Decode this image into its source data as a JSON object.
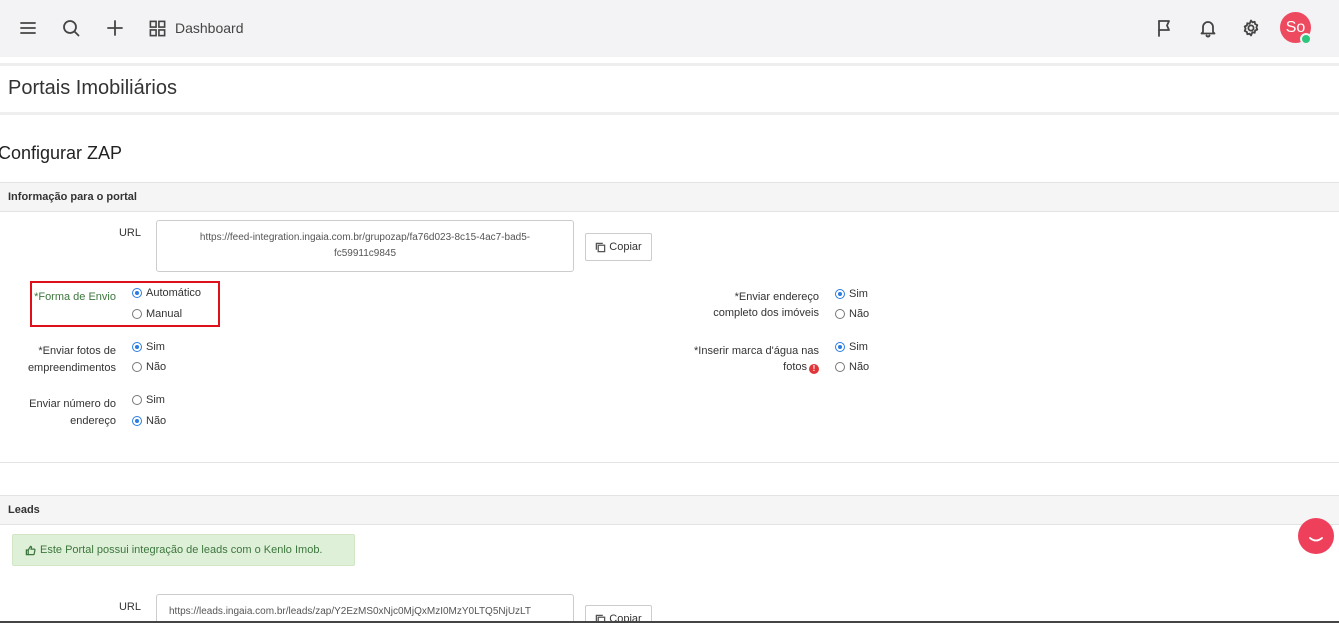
{
  "topbar": {
    "dashboard_label": "Dashboard",
    "avatar_initials": "So",
    "icons": [
      "menu-icon",
      "search-icon",
      "plus-icon",
      "grid-icon",
      "flag-icon",
      "bell-icon",
      "gear-icon"
    ]
  },
  "page": {
    "title": "Portais Imobiliários",
    "config_title": "Configurar ZAP"
  },
  "info_section": {
    "heading": "Informação para o portal",
    "url_label": "URL",
    "url_value": "https://feed-integration.ingaia.com.br/grupozap/fa76d023-8c15-4ac7-bad5-fc59911c9845",
    "copy_label": "Copiar",
    "forma_envio": {
      "label": "Forma de Envio",
      "options": [
        "Automático",
        "Manual"
      ],
      "selected": "Automático"
    },
    "enviar_fotos": {
      "label": "Enviar fotos de empreendimentos",
      "options": [
        "Sim",
        "Não"
      ],
      "selected": "Sim"
    },
    "enviar_numero": {
      "label": "Enviar número do endereço",
      "options": [
        "Sim",
        "Não"
      ],
      "selected": "Não"
    },
    "enviar_endereco": {
      "label": "Enviar endereço completo dos imóveis",
      "options": [
        "Sim",
        "Não"
      ],
      "selected": "Sim"
    },
    "marca_agua": {
      "label": "Inserir marca d'água nas fotos",
      "options": [
        "Sim",
        "Não"
      ],
      "selected": "Sim"
    },
    "required_mark": "*",
    "warn_glyph": "!"
  },
  "leads_section": {
    "heading": "Leads",
    "alert_text": "Este Portal possui integração de leads com o Kenlo Imob.",
    "url_label": "URL",
    "url_value": "https://leads.ingaia.com.br/leads/zap/Y2EzMS0xNjc0MjQxMzI0MzY0LTQ5NjUzLT",
    "copy_label": "Copiar"
  },
  "colors": {
    "accent": "#2a7de1",
    "highlight_border": "#e0101a",
    "avatar": "#ee4a5f",
    "success_bg": "#dff0d8",
    "success_text": "#3c763d"
  }
}
